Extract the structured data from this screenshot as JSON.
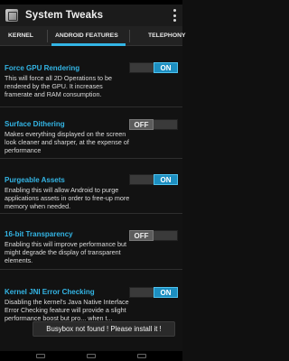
{
  "app": {
    "title": "System Tweaks",
    "icon": "app-logo-icon"
  },
  "tabs": [
    {
      "label": "KERNEL",
      "selected": false
    },
    {
      "label": "ANDROID FEATURES",
      "selected": true
    },
    {
      "label": "TELEPHONY",
      "selected": false
    }
  ],
  "settings": [
    {
      "title": "Force GPU Rendering",
      "description": "This will force all 2D Operations to be rendered by the GPU. It increases framerate and RAM consumption.",
      "toggle": "ON"
    },
    {
      "title": "Surface Dithering",
      "description": "Makes everything displayed on the screen look cleaner and sharper, at the expense of performance",
      "toggle": "OFF"
    },
    {
      "title": "Purgeable Assets",
      "description": "Enabling this will allow Android to purge applications assets in order to free-up more memory when needed.",
      "toggle": "ON"
    },
    {
      "title": "16-bit Transparency",
      "description": "Enabling this will improve performance but might degrade the display of transparent elements.",
      "toggle": "OFF"
    },
    {
      "title": "Kernel JNI Error Checking",
      "description": "Disabling the kernel's Java Native Interface Error Checking feature will provide a slight performance boost but pro... when t...",
      "toggle": "ON"
    }
  ],
  "toast": {
    "message": "Busybox not found ! Please install it !"
  },
  "colors": {
    "accent": "#33b5e5",
    "toggle_on": "#1d8fc1",
    "background": "#121212"
  }
}
